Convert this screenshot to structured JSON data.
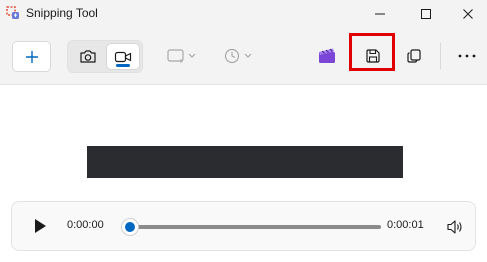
{
  "window": {
    "title": "Snipping Tool"
  },
  "toolbar": {
    "new_icon": "plus-icon",
    "mode_buttons": [
      "camera-icon",
      "video-camera-icon"
    ],
    "snip_shape_icon": "rectangle-snip-icon",
    "delay_icon": "clock-icon",
    "clipchamp_icon": "clipchamp-icon",
    "save_icon": "save-icon",
    "copy_icon": "copy-icon",
    "more_icon": "more-icon"
  },
  "player": {
    "current_time": "0:00:00",
    "total_time": "0:00:01",
    "progress": 0
  },
  "colors": {
    "accent": "#0067c0",
    "highlight": "#e00000",
    "preview_bar": "#2a2c2f"
  }
}
